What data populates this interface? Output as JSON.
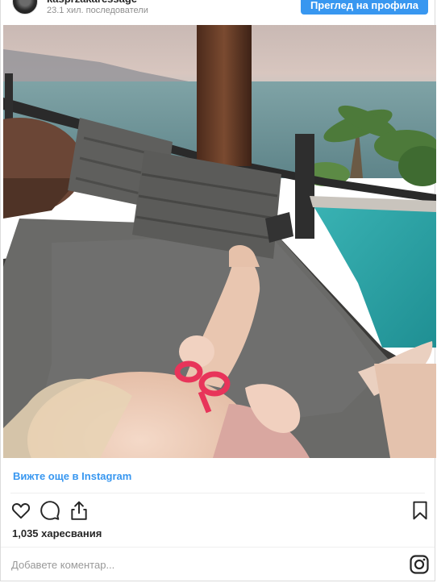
{
  "header": {
    "username": "kasprzakaressage",
    "followers": "23.1 хил. последователи",
    "view_profile_label": "Преглед на профила"
  },
  "photo": {
    "subject": "baby-on-daybed-sea-view"
  },
  "link": {
    "more_label": "Вижте още в Instagram"
  },
  "actions": {
    "icons": [
      "heart-icon",
      "comment-icon",
      "share-icon",
      "bookmark-icon"
    ]
  },
  "stats": {
    "likes": "1,035 харесвания"
  },
  "comment": {
    "placeholder": "Добавете коментар..."
  },
  "colors": {
    "accent": "#3897f0",
    "text": "#262626",
    "muted": "#8e8e8e",
    "border": "#dbdbdb"
  }
}
